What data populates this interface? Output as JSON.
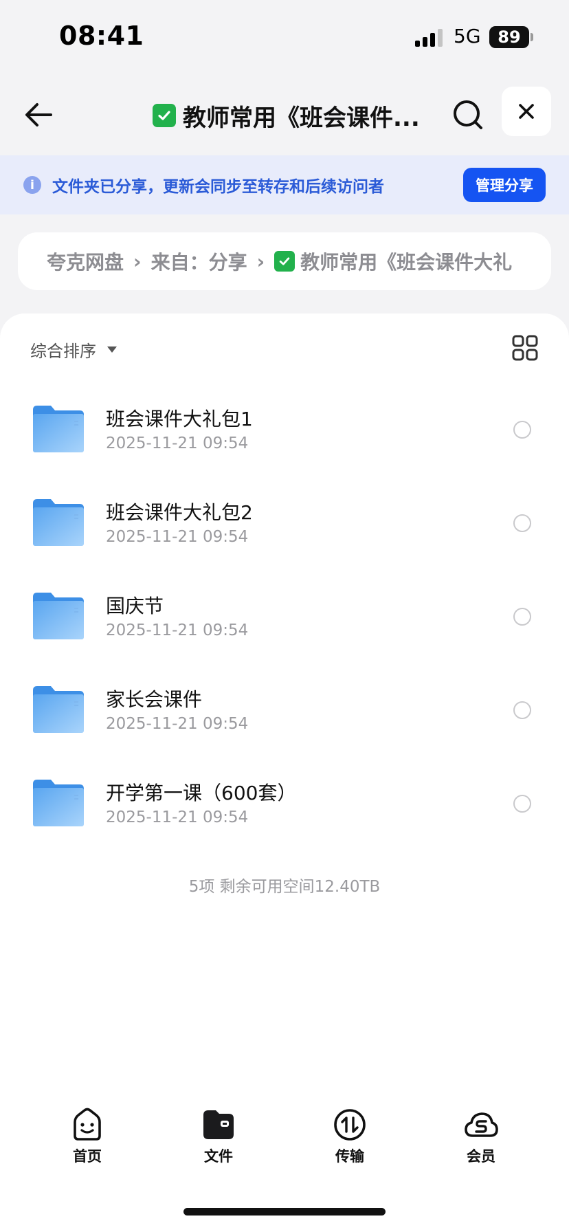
{
  "status_bar": {
    "time": "08:41",
    "network": "5G",
    "battery": "89"
  },
  "header": {
    "title": "教师常用《班会课件...",
    "back_icon": "arrow-left-icon",
    "search_icon": "search-icon",
    "close_icon": "close-icon"
  },
  "share_banner": {
    "text": "文件夹已分享，更新会同步至转存和后续访问者",
    "button": "管理分享",
    "accent": "#1554f2"
  },
  "breadcrumb": {
    "items": [
      "夸克网盘",
      "来自：分享",
      "教师常用《班会课件大礼"
    ],
    "separator": "›"
  },
  "toolbar": {
    "sort_label": "综合排序"
  },
  "files": [
    {
      "name": "班会课件大礼包1",
      "date": "2025-11-21 09:54"
    },
    {
      "name": "班会课件大礼包2",
      "date": "2025-11-21 09:54"
    },
    {
      "name": "国庆节",
      "date": "2025-11-21 09:54"
    },
    {
      "name": "家长会课件",
      "date": "2025-11-21 09:54"
    },
    {
      "name": "开学第一课（600套）",
      "date": "2025-11-21 09:54"
    }
  ],
  "summary": "5项 剩余可用空间12.40TB",
  "tabbar": {
    "items": [
      {
        "label": "首页",
        "icon": "home-face-icon"
      },
      {
        "label": "文件",
        "icon": "folder-icon"
      },
      {
        "label": "传输",
        "icon": "transfer-icon"
      },
      {
        "label": "会员",
        "icon": "cloud-icon"
      }
    ]
  }
}
